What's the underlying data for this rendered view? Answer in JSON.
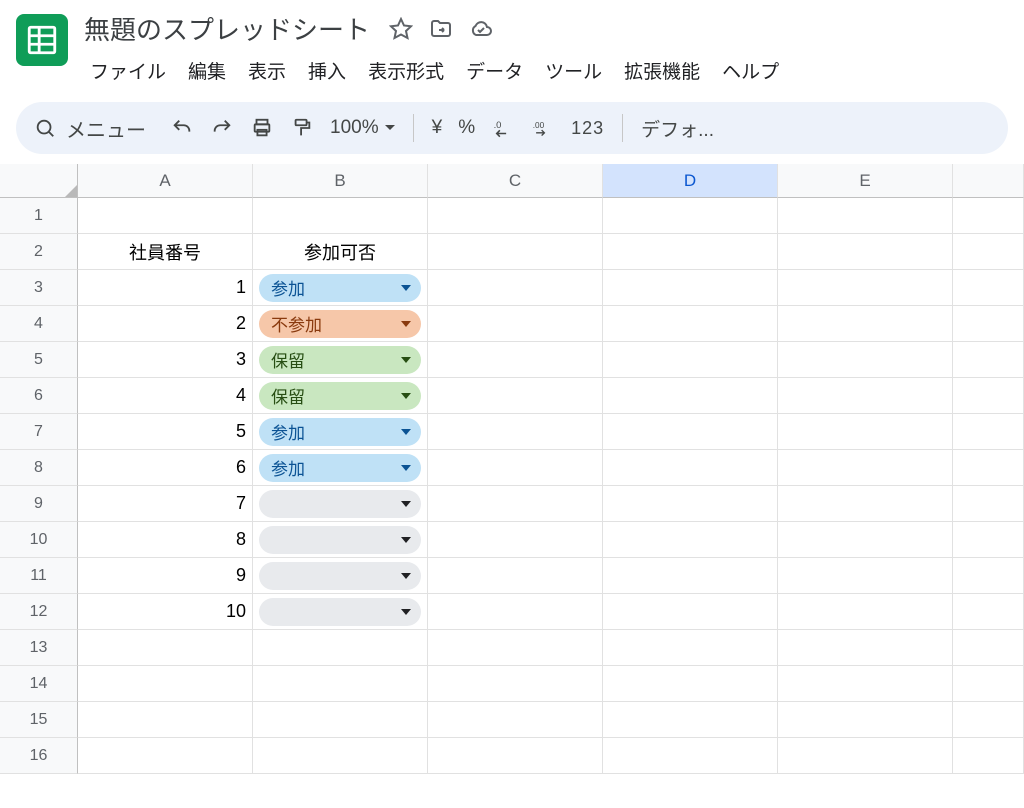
{
  "header": {
    "title": "無題のスプレッドシート"
  },
  "menubar": [
    "ファイル",
    "編集",
    "表示",
    "挿入",
    "表示形式",
    "データ",
    "ツール",
    "拡張機能",
    "ヘルプ"
  ],
  "toolbar": {
    "menu_search": "メニュー",
    "zoom": "100%",
    "currency": "¥",
    "percent": "%",
    "dec_dec": ".0",
    "inc_dec": ".00",
    "numfmt": "123",
    "font_trunc": "デフォ..."
  },
  "columns": [
    "A",
    "B",
    "C",
    "D",
    "E",
    ""
  ],
  "selected_column_index": 3,
  "row_numbers": [
    1,
    2,
    3,
    4,
    5,
    6,
    7,
    8,
    9,
    10,
    11,
    12,
    13,
    14,
    15,
    16
  ],
  "sheet": {
    "header_a": "社員番号",
    "header_b": "参加可否"
  },
  "rows": [
    {
      "id": "1",
      "status": "参加",
      "variant": "blue"
    },
    {
      "id": "2",
      "status": "不参加",
      "variant": "orange"
    },
    {
      "id": "3",
      "status": "保留",
      "variant": "green"
    },
    {
      "id": "4",
      "status": "保留",
      "variant": "green"
    },
    {
      "id": "5",
      "status": "参加",
      "variant": "blue"
    },
    {
      "id": "6",
      "status": "参加",
      "variant": "blue"
    },
    {
      "id": "7",
      "status": "",
      "variant": "empty"
    },
    {
      "id": "8",
      "status": "",
      "variant": "empty"
    },
    {
      "id": "9",
      "status": "",
      "variant": "empty"
    },
    {
      "id": "10",
      "status": "",
      "variant": "empty"
    }
  ]
}
